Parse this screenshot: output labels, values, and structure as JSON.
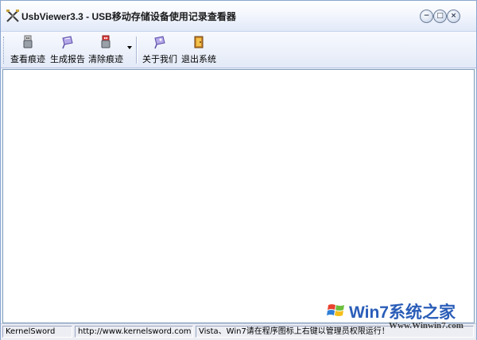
{
  "window": {
    "title": "UsbViewer3.3 - USB移动存储设备使用记录查看器",
    "controls": {
      "minimize": "−",
      "maximize": "□",
      "close": "×"
    }
  },
  "toolbar": {
    "buttons": [
      {
        "label": "查看痕迹",
        "icon": "view-usb-icon"
      },
      {
        "label": "生成报告",
        "icon": "report-icon"
      },
      {
        "label": "清除痕迹",
        "icon": "clear-usb-icon"
      },
      {
        "label": "关于我们",
        "icon": "about-icon"
      },
      {
        "label": "退出系统",
        "icon": "exit-icon"
      }
    ]
  },
  "statusbar": {
    "panel1": "KernelSword",
    "panel2": "http://www.kernelsword.com",
    "panel3": "Vista、Win7请在程序图标上右键以管理员权限运行！"
  },
  "watermark": {
    "brand": "Win7系统之家",
    "url": "Www.Winwin7.com"
  },
  "colors": {
    "accent": "#2a5db8",
    "title_gradient_end": "#e1e9f8",
    "border": "#7f9db9"
  }
}
